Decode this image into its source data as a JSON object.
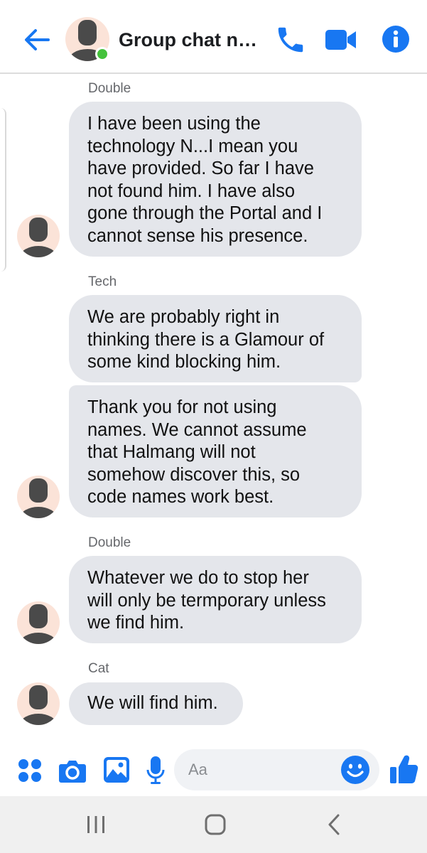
{
  "header": {
    "title": "Group chat na...",
    "back_icon": "back-arrow-icon",
    "call_icon": "phone-icon",
    "video_icon": "video-camera-icon",
    "info_icon": "info-icon",
    "accent_color": "#1877f2",
    "presence_color": "#44c23c"
  },
  "thread": {
    "groups": [
      {
        "sender": "Double",
        "messages": [
          "I have been using the\ntechnology N...I mean you\nhave provided. So far I have\nnot found him. I have also\ngone through the Portal and I\ncannot sense his presence."
        ]
      },
      {
        "sender": "Tech",
        "messages": [
          "We are probably right in\nthinking there is a Glamour of\nsome kind blocking him.",
          "Thank you for not using\nnames. We cannot assume\nthat Halmang will not\nsomehow discover this, so\ncode names work best."
        ]
      },
      {
        "sender": "Double",
        "messages": [
          "Whatever we do to stop her\nwill only be termporary unless\nwe find him."
        ]
      },
      {
        "sender": "Cat",
        "messages": [
          "We will find him."
        ]
      }
    ]
  },
  "composer": {
    "placeholder": "Aa",
    "icons": [
      "apps-icon",
      "camera-icon",
      "gallery-icon",
      "microphone-icon",
      "emoji-icon",
      "thumbs-up-icon"
    ]
  },
  "navbar": {
    "icons": [
      "recent-apps-icon",
      "home-icon",
      "back-icon"
    ]
  }
}
